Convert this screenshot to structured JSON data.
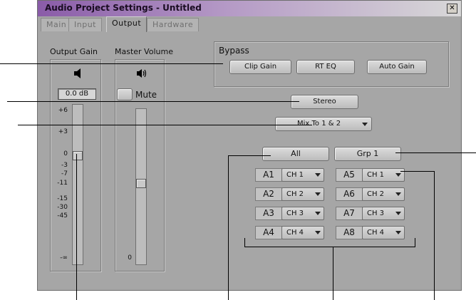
{
  "window": {
    "title": "Audio Project Settings - Untitled",
    "close_glyph": "✕"
  },
  "tabs": [
    {
      "label": "Main"
    },
    {
      "label": "Input"
    },
    {
      "label": "Output",
      "active": true
    },
    {
      "label": "Hardware"
    }
  ],
  "output_gain": {
    "label": "Output Gain",
    "icon": "speaker-icon",
    "value": "0.0 dB",
    "ticks": [
      "+6",
      "+3",
      "0",
      "-3",
      "-7",
      "-11",
      "-15",
      "-30",
      "-45",
      "-∞"
    ]
  },
  "master_volume": {
    "label": "Master Volume",
    "icon": "speaker-volume-icon",
    "mute_label": "Mute",
    "ticks": [
      "0"
    ]
  },
  "bypass": {
    "label": "Bypass",
    "buttons": [
      "Clip Gain",
      "RT EQ",
      "Auto Gain"
    ]
  },
  "output_mode": "Stereo",
  "mix_select": "Mix To 1 & 2",
  "track_buttons": {
    "all": "All",
    "group": "Grp 1"
  },
  "tracks": [
    {
      "name": "A1",
      "channel": "CH 1"
    },
    {
      "name": "A2",
      "channel": "CH 2"
    },
    {
      "name": "A3",
      "channel": "CH 3"
    },
    {
      "name": "A4",
      "channel": "CH 4"
    },
    {
      "name": "A5",
      "channel": "CH 1"
    },
    {
      "name": "A6",
      "channel": "CH 2"
    },
    {
      "name": "A7",
      "channel": "CH 3"
    },
    {
      "name": "A8",
      "channel": "CH 4"
    }
  ]
}
